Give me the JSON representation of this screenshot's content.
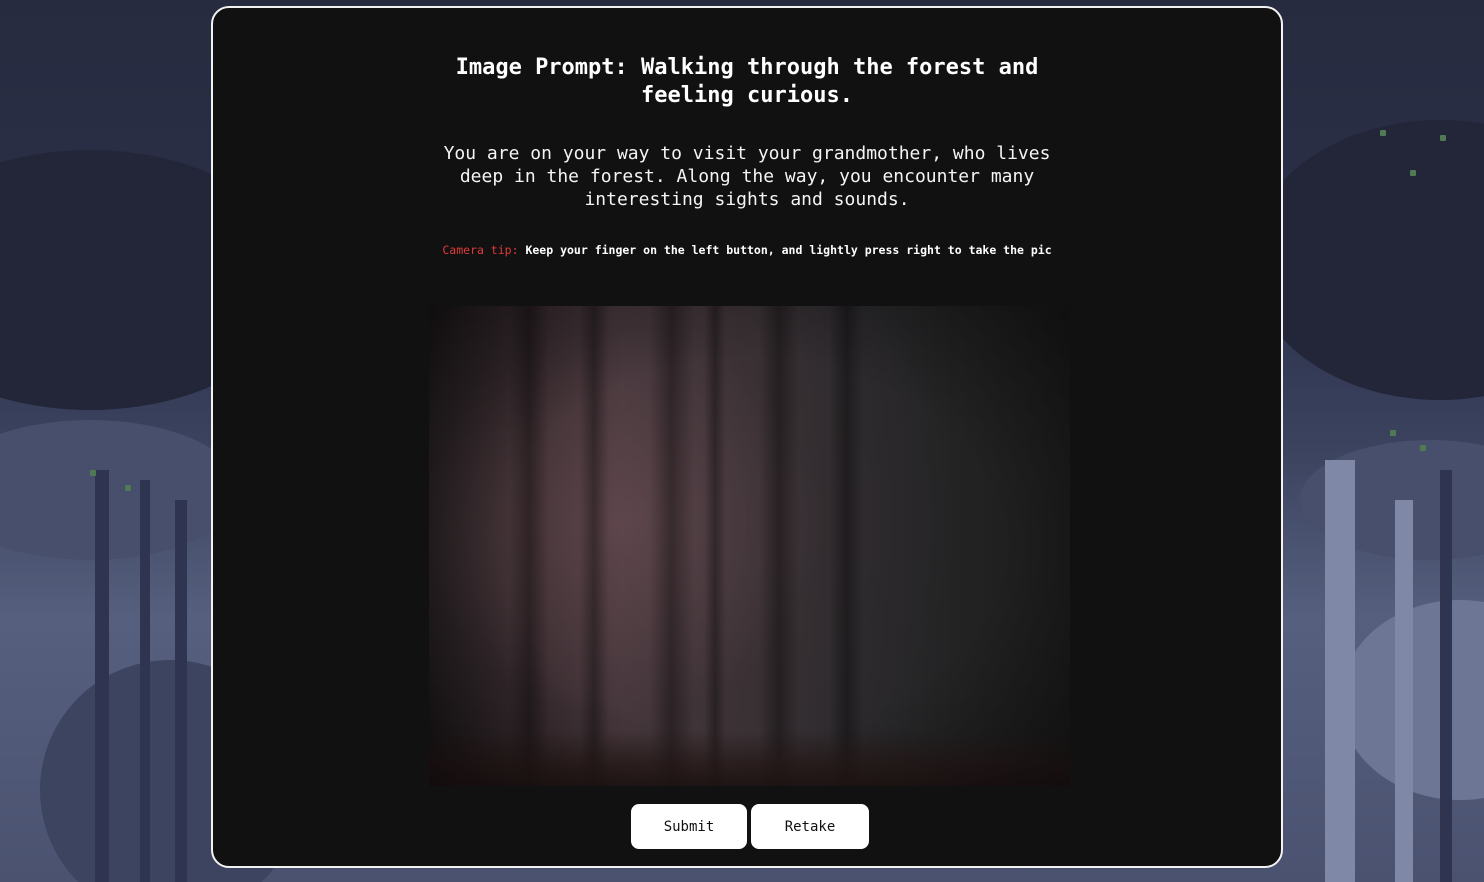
{
  "prompt": {
    "title": "Image Prompt: Walking through the forest and feeling curious.",
    "story": "You are on your way to visit your grandmother, who lives deep in the forest. Along the way, you encounter many interesting sights and sounds."
  },
  "camera_tip": {
    "label": "Camera tip:",
    "text": "Keep your finger on the left button, and lightly press right to take the pic"
  },
  "buttons": {
    "submit": "Submit",
    "retake": "Retake"
  },
  "colors": {
    "card_background": "#111111",
    "card_border": "#f2f2f2",
    "tip_label": "#e03a3a",
    "button_background": "#ffffff"
  }
}
